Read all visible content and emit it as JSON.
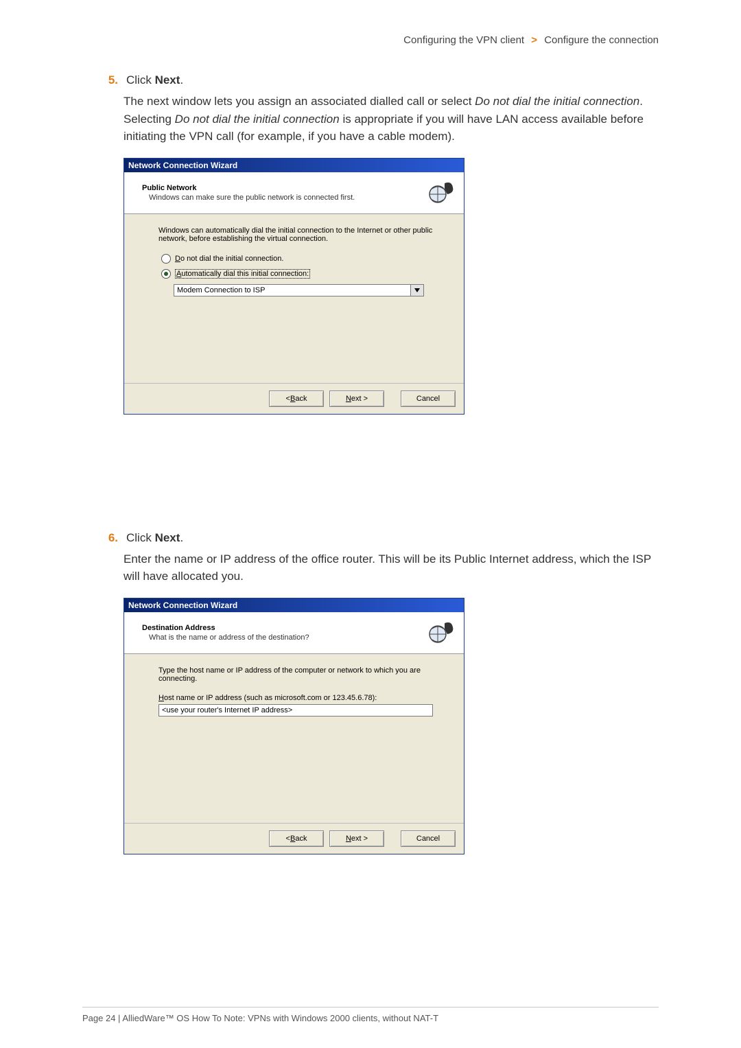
{
  "breadcrumb": {
    "left": "Configuring the VPN client",
    "right": "Configure the connection"
  },
  "step5": {
    "num": "5.",
    "click": "Click",
    "next_word": "Next",
    "period": ".",
    "para_a": "The next window lets you assign an associated dialled call or select ",
    "para_ital1": "Do not dial the initial connection",
    "para_b": ". Selecting ",
    "para_ital2": "Do not dial the initial connection",
    "para_c": " is appropriate if you will have LAN access available before initiating the VPN call (for example, if you have a cable modem)."
  },
  "wizard1": {
    "title": "Network Connection Wizard",
    "headerTitle": "Public Network",
    "headerSub": "Windows can make sure the public network is connected first.",
    "intro": "Windows can automatically dial the initial connection to the Internet or other public network, before establishing the virtual connection.",
    "radio1_pre_ul": "D",
    "radio1_rest": "o not dial the initial connection.",
    "radio2_pre_ul": "A",
    "radio2_rest": "utomatically dial this initial connection:",
    "combo_value": "Modem Connection to ISP",
    "back_pre": "< ",
    "back_ul": "B",
    "back_rest": "ack",
    "next_ul": "N",
    "next_rest": "ext >",
    "cancel": "Cancel"
  },
  "step6": {
    "num": "6.",
    "click": "Click",
    "next_word": "Next",
    "period": ".",
    "para": "Enter the name or IP address of the office router. This will be its Public Internet address, which the ISP will have allocated you."
  },
  "wizard2": {
    "title": "Network Connection Wizard",
    "headerTitle": "Destination Address",
    "headerSub": "What is the name or address of the destination?",
    "intro": "Type the host name or IP address of the computer or network to which you are connecting.",
    "label_ul": "H",
    "label_rest": "ost name or IP address (such as microsoft.com or 123.45.6.78):",
    "input_value": "<use your router's Internet IP address>",
    "back_pre": "< ",
    "back_ul": "B",
    "back_rest": "ack",
    "next_ul": "N",
    "next_rest": "ext >",
    "cancel": "Cancel"
  },
  "footer": "Page 24 | AlliedWare™ OS How To Note: VPNs with Windows 2000 clients, without NAT-T"
}
